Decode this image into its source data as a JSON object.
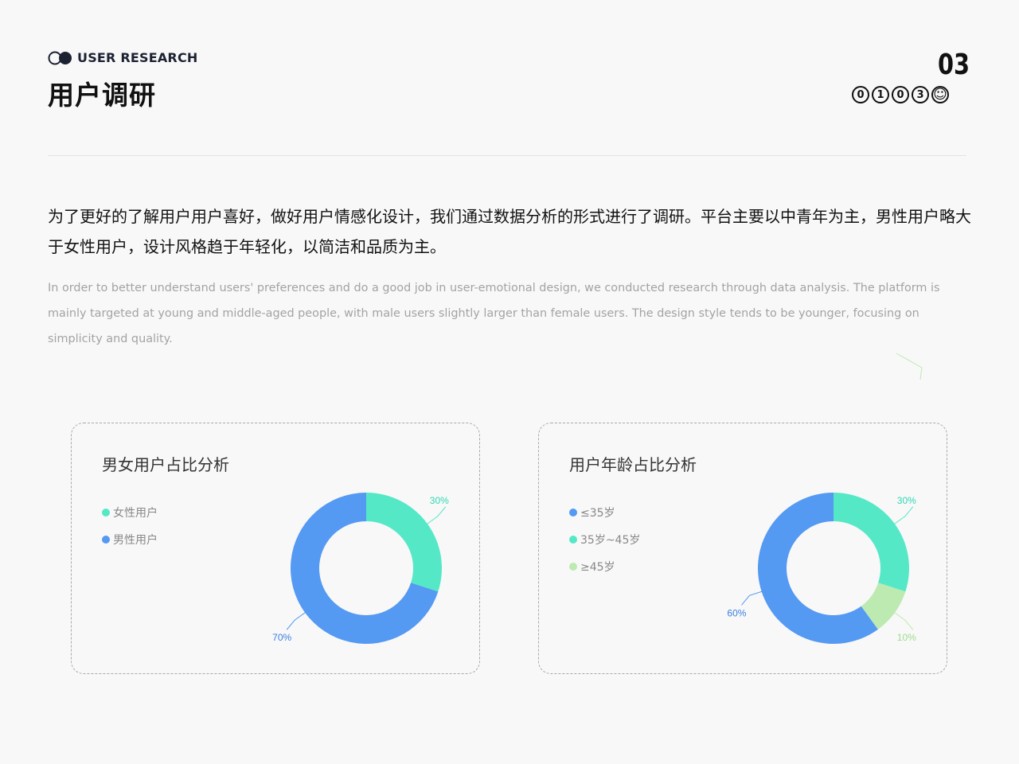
{
  "header": {
    "eyebrow": "USER RESEARCH",
    "title": "用户调研",
    "page_number": "03",
    "badges": [
      "0",
      "1",
      "0",
      "3",
      "☺"
    ]
  },
  "intro": {
    "cn": "为了更好的了解用户用户喜好，做好用户情感化设计，我们通过数据分析的形式进行了调研。平台主要以中青年为主，男性用户略大于女性用户，设计风格趋于年轻化，以简洁和品质为主。",
    "en": "In order to better understand users' preferences and do a good job in user-emotional design, we conducted research through data analysis. The platform is mainly targeted at young and middle-aged people, with male users slightly larger than female users. The design style tends to be younger, focusing on simplicity and quality."
  },
  "colors": {
    "blue": "#5499f2",
    "teal": "#55e8c7",
    "green": "#bceab1",
    "blue_text": "#3a7fe0",
    "teal_text": "#2fd7b3",
    "green_text": "#9fdc8f"
  },
  "chart_data": [
    {
      "type": "pie",
      "title": "男女用户占比分析",
      "legend_position": "left",
      "categories": [
        "女性用户",
        "男性用户"
      ],
      "values": [
        30,
        70
      ],
      "labels": [
        "30%",
        "70%"
      ],
      "colors": [
        "#55e8c7",
        "#5499f2"
      ],
      "label_colors": [
        "#2fd7b3",
        "#3a7fe0"
      ],
      "label_sides": [
        "right",
        "left"
      ]
    },
    {
      "type": "pie",
      "title": "用户年龄占比分析",
      "legend_position": "left",
      "categories": [
        "≤35岁",
        "35岁~45岁",
        "≥45岁"
      ],
      "legend_colors": [
        "#5499f2",
        "#55e8c7",
        "#bceab1"
      ],
      "slice_order": [
        "35岁~45岁",
        "≥45岁",
        "≤35岁"
      ],
      "values": [
        30,
        10,
        60
      ],
      "labels": [
        "30%",
        "10%",
        "60%"
      ],
      "colors": [
        "#55e8c7",
        "#bceab1",
        "#5499f2"
      ],
      "label_colors": [
        "#2fd7b3",
        "#9fdc8f",
        "#3a7fe0"
      ],
      "label_sides": [
        "right",
        "right",
        "left"
      ]
    }
  ]
}
